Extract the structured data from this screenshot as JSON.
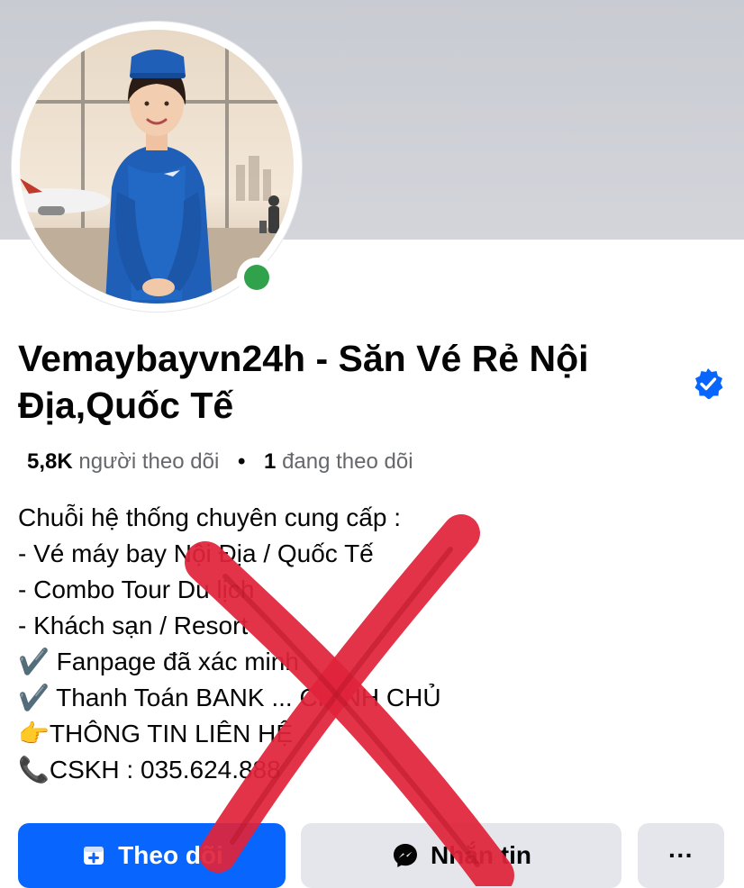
{
  "profile": {
    "name": "Vemaybayvn24h - Săn Vé Rẻ Nội Địa,Quốc Tế",
    "followers_count": "5,8K",
    "followers_label": "người theo dõi",
    "separator": "•",
    "following_count": "1",
    "following_label": "đang theo dõi",
    "status": "online"
  },
  "bio": [
    "Chuỗi hệ thống chuyên cung cấp :",
    "- Vé máy bay Nội Địa / Quốc Tế",
    "- Combo Tour Du lịch",
    "- Khách sạn / Resort",
    "✔️ Fanpage đã xác minh",
    "✔️ Thanh Toán BANK ... CHÍNH CHỦ",
    "👉THÔNG TIN LIÊN HỆ",
    "📞CSKH : 035.624.888"
  ],
  "actions": {
    "follow_label": "Theo dõi",
    "message_label": "Nhắn tin",
    "more_label": "···"
  },
  "icons": {
    "verified": "verified-badge-icon",
    "follow": "follow-icon",
    "messenger": "messenger-icon",
    "more": "more-icon"
  },
  "colors": {
    "primary": "#0866ff",
    "online": "#31a24c",
    "secondary_button": "#e4e6eb",
    "overlay_x": "#e0243a"
  }
}
